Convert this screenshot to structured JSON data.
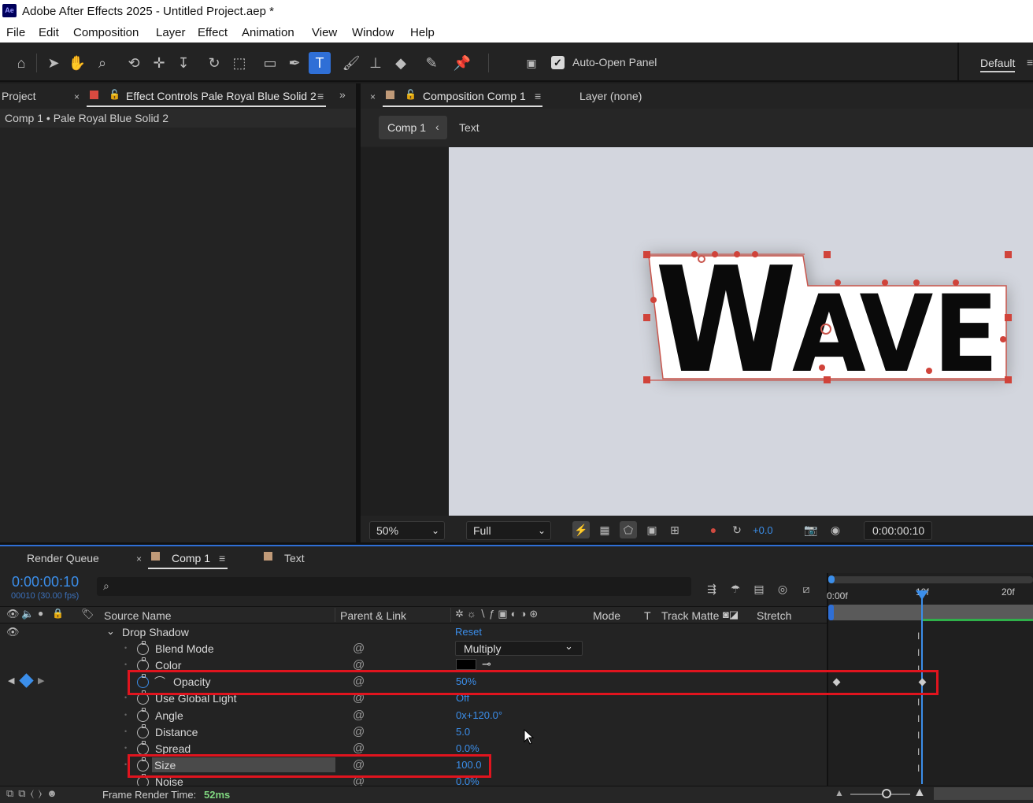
{
  "app": {
    "title": "Adobe After Effects 2025 - Untitled Project.aep *",
    "logo": "Ae"
  },
  "menu": [
    "File",
    "Edit",
    "Composition",
    "Layer",
    "Effect",
    "Animation",
    "View",
    "Window",
    "Help"
  ],
  "toolbar": {
    "auto_open_panel": "Auto-Open Panel",
    "auto_open_checked": true,
    "workspace": "Default"
  },
  "left_panel": {
    "project_tab": "Project",
    "effect_tab": "Effect Controls Pale Royal Blue Solid 2",
    "breadcrumb": "Comp 1 • Pale Royal Blue Solid 2"
  },
  "comp_panel": {
    "tab": "Composition Comp 1",
    "layer_tab": "Layer (none)",
    "crumb_comp": "Comp 1",
    "crumb_layer": "Text",
    "canvas_text": "WAVE",
    "zoom": "50%",
    "resolution": "Full",
    "exposure": "+0.0",
    "timecode": "0:00:00:10"
  },
  "timeline": {
    "tabs": {
      "render_queue": "Render Queue",
      "comp": "Comp 1",
      "text": "Text"
    },
    "timecode": "0:00:00:10",
    "frame_info": "00010 (30.00 fps)",
    "search_icon": "search-icon",
    "columns": {
      "source_name": "Source Name",
      "parent_link": "Parent & Link",
      "mode": "Mode",
      "t": "T",
      "track_matte": "Track Matte",
      "stretch": "Stretch"
    },
    "ruler": {
      "start": "0:00f",
      "mid": "10f",
      "end": "20f"
    },
    "group": {
      "name": "Drop Shadow",
      "reset": "Reset"
    },
    "properties": [
      {
        "name": "Blend Mode",
        "value": "Multiply"
      },
      {
        "name": "Color",
        "value": ""
      },
      {
        "name": "Opacity",
        "value": "50%"
      },
      {
        "name": "Use Global Light",
        "value": "Off"
      },
      {
        "name": "Angle",
        "value": "0x+120.0°"
      },
      {
        "name": "Distance",
        "value": "5.0"
      },
      {
        "name": "Spread",
        "value": "0.0%"
      },
      {
        "name": "Size",
        "value": "100.0"
      },
      {
        "name": "Noise",
        "value": "0.0%"
      }
    ],
    "footer": {
      "label": "Frame Render Time:",
      "value": "52ms"
    }
  },
  "colors": {
    "accent": "#2f6fd6",
    "value_blue": "#3b8eea",
    "highlight_red": "#e0141e",
    "handle_red": "#d0433a",
    "canvas_bg": "#d3d6de"
  }
}
